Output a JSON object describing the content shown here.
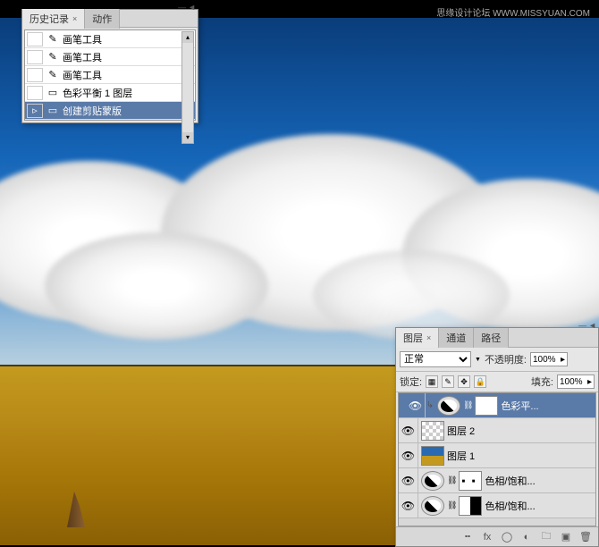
{
  "watermark": {
    "right": "思缘设计论坛  WWW.MISSYUAN.COM"
  },
  "history_panel": {
    "tabs": [
      {
        "label": "历史记录",
        "active": true
      },
      {
        "label": "动作",
        "active": false
      }
    ],
    "items": [
      {
        "icon": "brush",
        "label": "画笔工具",
        "selected": false
      },
      {
        "icon": "brush",
        "label": "画笔工具",
        "selected": false
      },
      {
        "icon": "brush",
        "label": "画笔工具",
        "selected": false
      },
      {
        "icon": "layer",
        "label": "色彩平衡 1 图层",
        "selected": false
      },
      {
        "icon": "layer",
        "label": "创建剪贴蒙版",
        "selected": true
      }
    ]
  },
  "layers_panel": {
    "tabs": [
      {
        "label": "图层",
        "active": true
      },
      {
        "label": "通道",
        "active": false
      },
      {
        "label": "路径",
        "active": false
      }
    ],
    "blend_mode": "正常",
    "opacity_label": "不透明度:",
    "opacity_value": "100%",
    "lock_label": "锁定:",
    "fill_label": "填充:",
    "fill_value": "100%",
    "layers": [
      {
        "name": "色彩平...",
        "type": "adjustment",
        "mask": "white",
        "visible": true,
        "selected": true,
        "clipped": true
      },
      {
        "name": "图层 2",
        "type": "checker",
        "visible": true,
        "selected": false
      },
      {
        "name": "图层 1",
        "type": "image",
        "visible": true,
        "selected": false
      },
      {
        "name": "色相/饱和...",
        "type": "adjustment",
        "mask": "dots",
        "visible": true,
        "selected": false
      },
      {
        "name": "色相/饱和...",
        "type": "adjustment",
        "mask": "partial",
        "visible": true,
        "selected": false
      }
    ]
  }
}
